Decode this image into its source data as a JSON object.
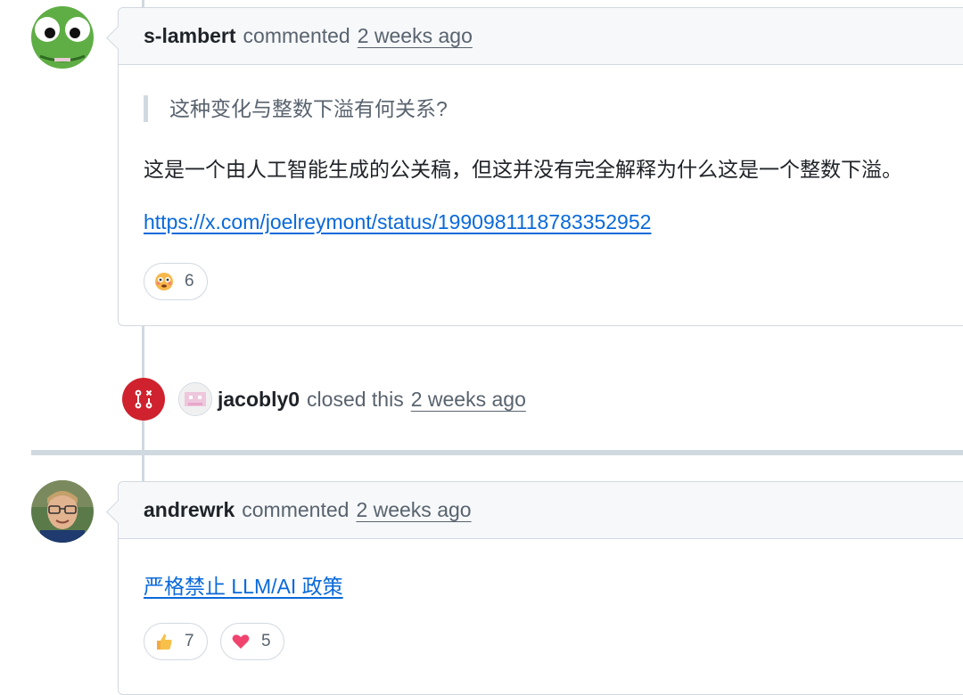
{
  "comments": [
    {
      "author": "s-lambert",
      "verb": "commented",
      "time": "2 weeks ago",
      "quote": "这种变化与整数下溢有何关系?",
      "text": "这是一个由人工智能生成的公关稿，但这并没有完全解释为什么这是一个整数下溢。",
      "link": "https://x.com/joelreymont/status/1990981118783352952",
      "reactions": [
        {
          "icon": "flushed-face-emoji",
          "count": "6"
        }
      ]
    },
    {
      "author": "andrewrk",
      "verb": "commented",
      "time": "2 weeks ago",
      "link": "严格禁止 LLM/AI 政策",
      "reactions": [
        {
          "icon": "thumbs-up-emoji",
          "count": "7"
        },
        {
          "icon": "heart-emoji",
          "count": "5"
        }
      ]
    }
  ],
  "closed_event": {
    "author": "jacobly0",
    "verb": "closed this",
    "time": "2 weeks ago",
    "icon": "git-pull-request-closed-icon",
    "badge_color": "#cf222e"
  },
  "colors": {
    "link": "#0969da",
    "border": "#d1d9e0",
    "header_bg": "#f6f8fa"
  }
}
